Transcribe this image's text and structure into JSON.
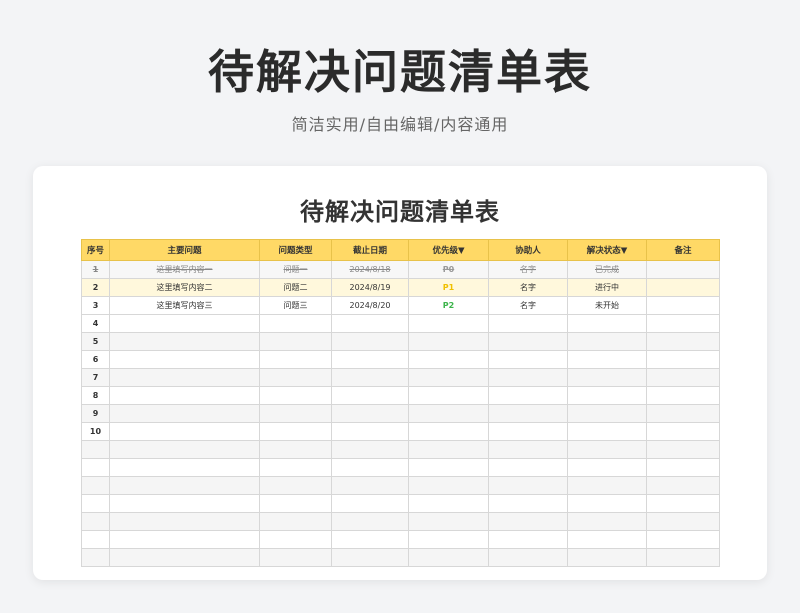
{
  "header": {
    "title": "待解决问题清单表",
    "subtitle": "简洁实用/自由编辑/内容通用"
  },
  "sheet": {
    "title": "待解决问题清单表",
    "columns": [
      "序号",
      "主要问题",
      "问题类型",
      "截止日期",
      "优先级▼",
      "协助人",
      "解决状态▼",
      "备注"
    ],
    "rows": [
      {
        "no": "1",
        "issue": "这里填写内容一",
        "type": "问题一",
        "date": "2024/8/18",
        "priority": "P0",
        "helper": "名字",
        "status": "已完成",
        "note": ""
      },
      {
        "no": "2",
        "issue": "这里填写内容二",
        "type": "问题二",
        "date": "2024/8/19",
        "priority": "P1",
        "helper": "名字",
        "status": "进行中",
        "note": ""
      },
      {
        "no": "3",
        "issue": "这里填写内容三",
        "type": "问题三",
        "date": "2024/8/20",
        "priority": "P2",
        "helper": "名字",
        "status": "未开始",
        "note": ""
      },
      {
        "no": "4"
      },
      {
        "no": "5"
      },
      {
        "no": "6"
      },
      {
        "no": "7"
      },
      {
        "no": "8"
      },
      {
        "no": "9"
      },
      {
        "no": "10"
      },
      {
        "no": ""
      },
      {
        "no": ""
      },
      {
        "no": ""
      },
      {
        "no": ""
      },
      {
        "no": ""
      },
      {
        "no": ""
      },
      {
        "no": ""
      }
    ]
  },
  "colors": {
    "header_fill": "#ffd966",
    "in_progress_fill": "#fff8dc",
    "p1": "#f0c000",
    "p2": "#3cb44b"
  }
}
